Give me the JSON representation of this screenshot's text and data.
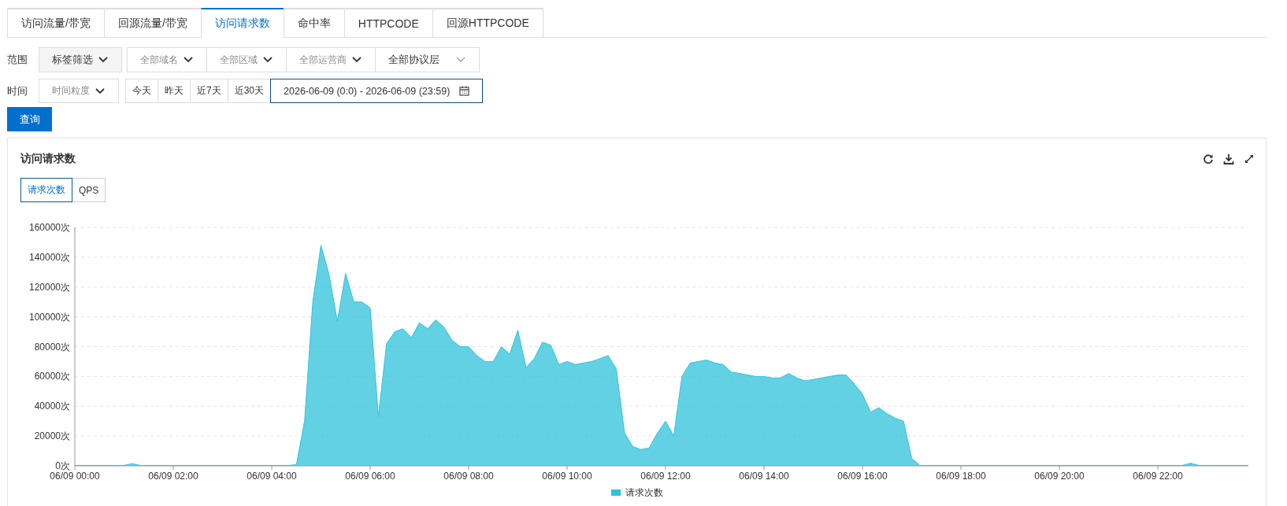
{
  "tabs": [
    {
      "label": "访问流量/带宽",
      "selected": false
    },
    {
      "label": "回源流量/带宽",
      "selected": false
    },
    {
      "label": "访问请求数",
      "selected": true
    },
    {
      "label": "命中率",
      "selected": false
    },
    {
      "label": "HTTPCODE",
      "selected": false
    },
    {
      "label": "回源HTTPCODE",
      "selected": false
    }
  ],
  "scope": {
    "label": "范围",
    "selects": [
      {
        "label": "标签筛选",
        "kind": "tag"
      },
      {
        "label": "全部域名",
        "kind": "muted"
      },
      {
        "label": "全部区域",
        "kind": "muted"
      },
      {
        "label": "全部运营商",
        "kind": "muted"
      },
      {
        "label": "全部协议层",
        "kind": "plain"
      }
    ]
  },
  "time": {
    "label": "时间",
    "granularity": {
      "placeholder": "时间粒度"
    },
    "quick_ranges": [
      {
        "label": "今天",
        "selected": false
      },
      {
        "label": "昨天",
        "selected": false
      },
      {
        "label": "近7天",
        "selected": false
      },
      {
        "label": "近30天",
        "selected": false
      }
    ],
    "date_range": "2026-06-09 (0:0) - 2026-06-09 (23:59)"
  },
  "query_button": "查询",
  "panel": {
    "title": "访问请求数",
    "metric_toggle": [
      {
        "label": "请求次数",
        "selected": true
      },
      {
        "label": "QPS",
        "selected": false
      }
    ],
    "chart_data": {
      "type": "area",
      "categories": [
        "06/09 00:00",
        null,
        null,
        null,
        null,
        null,
        null,
        null,
        null,
        null,
        null,
        null,
        "06/09 02:00",
        null,
        null,
        null,
        null,
        null,
        null,
        null,
        null,
        null,
        null,
        null,
        "06/09 04:00",
        null,
        null,
        null,
        null,
        null,
        null,
        null,
        null,
        null,
        null,
        null,
        "06/09 06:00",
        null,
        null,
        null,
        null,
        null,
        null,
        null,
        null,
        null,
        null,
        null,
        "06/09 08:00",
        null,
        null,
        null,
        null,
        null,
        null,
        null,
        null,
        null,
        null,
        null,
        "06/09 10:00",
        null,
        null,
        null,
        null,
        null,
        null,
        null,
        null,
        null,
        null,
        null,
        "06/09 12:00",
        null,
        null,
        null,
        null,
        null,
        null,
        null,
        null,
        null,
        null,
        null,
        "06/09 14:00",
        null,
        null,
        null,
        null,
        null,
        null,
        null,
        null,
        null,
        null,
        null,
        "06/09 16:00",
        null,
        null,
        null,
        null,
        null,
        null,
        null,
        null,
        null,
        null,
        null,
        "06/09 18:00",
        null,
        null,
        null,
        null,
        null,
        null,
        null,
        null,
        null,
        null,
        null,
        "06/09 20:00",
        null,
        null,
        null,
        null,
        null,
        null,
        null,
        null,
        null,
        null,
        null,
        "06/09 22:00",
        null,
        null,
        null,
        null,
        null,
        null,
        null,
        null,
        null,
        null,
        null
      ],
      "series": [
        {
          "name": "请求次数",
          "color": "#2fc2db",
          "values": [
            300,
            300,
            300,
            300,
            300,
            300,
            300,
            1500,
            300,
            300,
            300,
            300,
            300,
            300,
            300,
            300,
            300,
            300,
            300,
            300,
            300,
            300,
            300,
            300,
            300,
            300,
            300,
            800,
            30000,
            110000,
            148000,
            128000,
            97000,
            129000,
            110000,
            110000,
            106000,
            33000,
            82000,
            90000,
            92000,
            86000,
            96000,
            92000,
            98000,
            93000,
            84000,
            80000,
            80000,
            74000,
            70000,
            70000,
            80000,
            75000,
            91000,
            66000,
            72000,
            83000,
            81000,
            68000,
            70000,
            68000,
            69000,
            70000,
            72000,
            74000,
            65000,
            22000,
            13000,
            11000,
            12000,
            22000,
            30000,
            20000,
            60000,
            69000,
            70000,
            71000,
            69000,
            68000,
            63000,
            62000,
            61000,
            60000,
            60000,
            59000,
            59000,
            62000,
            59000,
            57000,
            58000,
            59000,
            60000,
            61000,
            61000,
            55000,
            48000,
            36000,
            39000,
            35000,
            32000,
            30000,
            5000,
            300,
            300,
            300,
            300,
            300,
            300,
            300,
            300,
            300,
            300,
            300,
            300,
            300,
            300,
            300,
            300,
            300,
            300,
            300,
            300,
            300,
            300,
            300,
            300,
            300,
            300,
            300,
            300,
            300,
            300,
            300,
            300,
            300,
            1800,
            300,
            300,
            300,
            300,
            300,
            300,
            300
          ]
        }
      ],
      "ylim": [
        0,
        160000
      ],
      "grid": true,
      "yticks": [
        {
          "value": 0,
          "label": "0次"
        },
        {
          "value": 20000,
          "label": "20000次"
        },
        {
          "value": 40000,
          "label": "40000次"
        },
        {
          "value": 60000,
          "label": "60000次"
        },
        {
          "value": 80000,
          "label": "80000次"
        },
        {
          "value": 100000,
          "label": "100000次"
        },
        {
          "value": 120000,
          "label": "120000次"
        },
        {
          "value": 140000,
          "label": "140000次"
        },
        {
          "value": 160000,
          "label": "160000次"
        }
      ]
    }
  }
}
